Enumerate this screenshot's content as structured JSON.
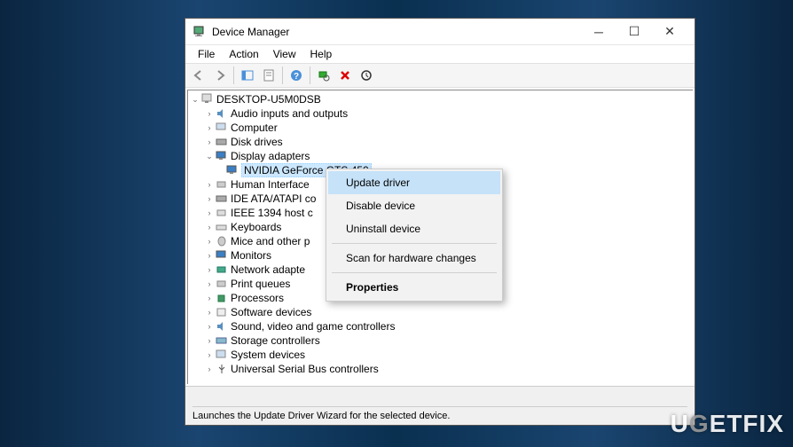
{
  "window": {
    "title": "Device Manager"
  },
  "menubar": {
    "file": "File",
    "action": "Action",
    "view": "View",
    "help": "Help"
  },
  "tree": {
    "root": "DESKTOP-U5M0DSB",
    "nodes": [
      "Audio inputs and outputs",
      "Computer",
      "Disk drives",
      "Display adapters",
      "Human Interface",
      "IDE ATA/ATAPI co",
      "IEEE 1394 host c",
      "Keyboards",
      "Mice and other p",
      "Monitors",
      "Network adapte",
      "Print queues",
      "Processors",
      "Software devices",
      "Sound, video and game controllers",
      "Storage controllers",
      "System devices",
      "Universal Serial Bus controllers"
    ],
    "selected_device": "NVIDIA GeForce GTS 450"
  },
  "context_menu": {
    "update": "Update driver",
    "disable": "Disable device",
    "uninstall": "Uninstall device",
    "scan": "Scan for hardware changes",
    "properties": "Properties"
  },
  "statusbar": {
    "text": "Launches the Update Driver Wizard for the selected device."
  },
  "watermark": "UGETFIX"
}
